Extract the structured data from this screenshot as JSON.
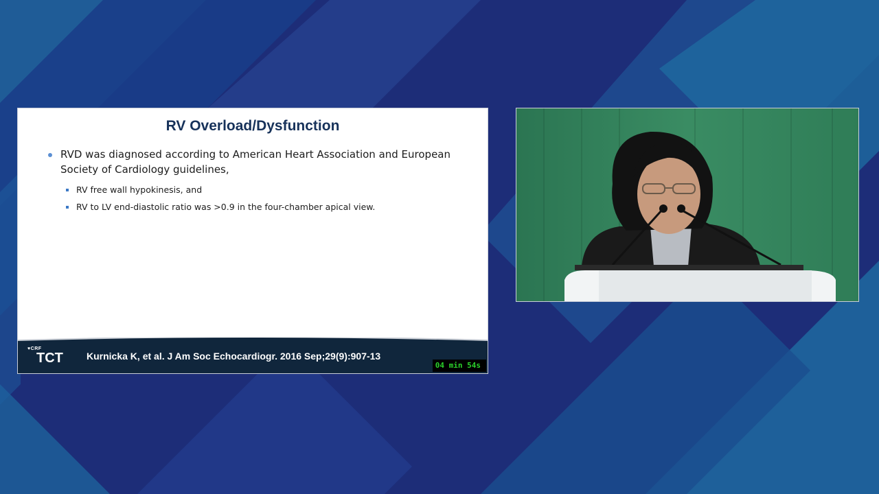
{
  "slide": {
    "title": "RV Overload/Dysfunction",
    "bullets": [
      {
        "text": "RVD was diagnosed according to American Heart Association and European Society of Cardiology guidelines,",
        "sub": [
          "RV free wall hypokinesis, and",
          "RV to LV end-diastolic ratio was >0.9 in the four-chamber apical view."
        ]
      }
    ],
    "footer": {
      "logo_small": "CRF",
      "logo_main": "TCT",
      "citation": "Kurnicka K, et al. J Am Soc Echocardiogr. 2016 Sep;29(9):907-13",
      "timer": "04 min 54s"
    }
  },
  "colors": {
    "background": "#1b2f7a",
    "slide_title": "#17325a",
    "footer": "#10263c",
    "timer_text": "#2bd12b",
    "video_backdrop": "#2f7e58"
  }
}
